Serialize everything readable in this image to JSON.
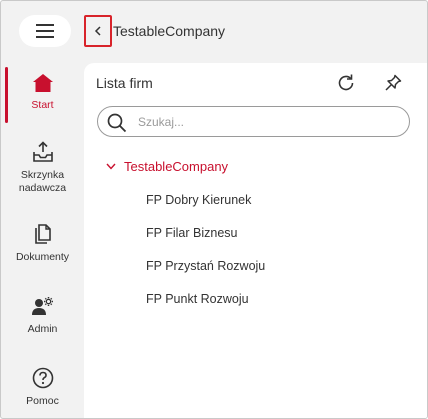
{
  "header": {
    "title": "TestableCompany",
    "menu_icon": "hamburger-icon",
    "back_icon": "chevron-left-icon"
  },
  "nav": {
    "items": [
      {
        "label": "Start",
        "icon": "home-icon",
        "active": true
      },
      {
        "label": "Skrzynka nadawcza",
        "icon": "outbox-icon",
        "active": false
      },
      {
        "label": "Dokumenty",
        "icon": "documents-icon",
        "active": false
      },
      {
        "label": "Admin",
        "icon": "admin-icon",
        "active": false
      },
      {
        "label": "Pomoc",
        "icon": "help-icon",
        "active": false
      }
    ]
  },
  "panel": {
    "title": "Lista firm",
    "search_placeholder": "Szukaj...",
    "tree": {
      "root": "TestableCompany",
      "expanded": true,
      "children": [
        "FP Dobry Kierunek",
        "FP Filar Biznesu",
        "FP Przystań Rozwoju",
        "FP Punkt Rozwoju"
      ]
    }
  },
  "colors": {
    "accent": "#c8102e",
    "highlight_border": "#d8232a",
    "background": "#f2f2f2"
  }
}
